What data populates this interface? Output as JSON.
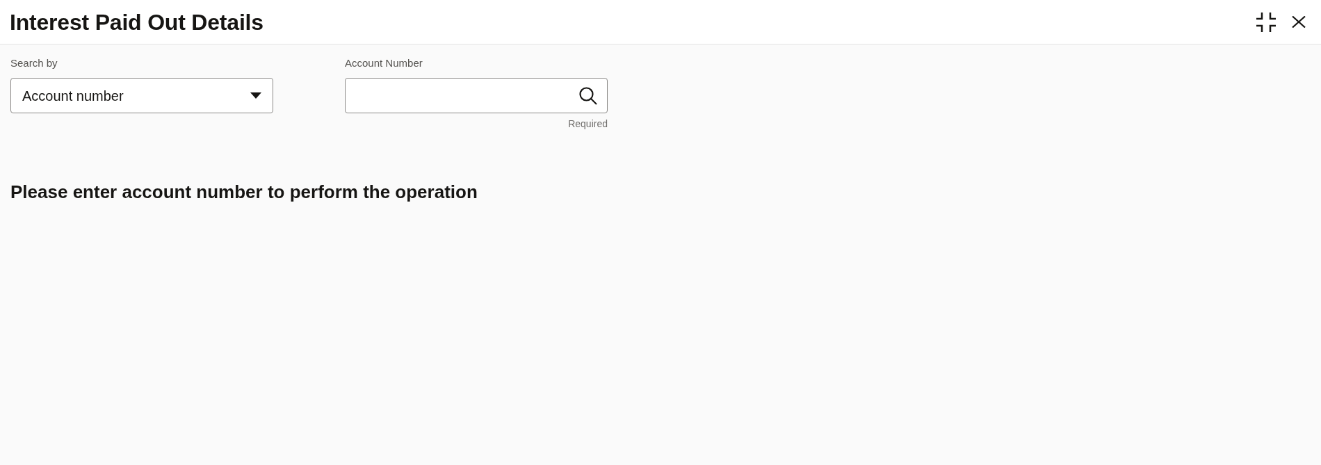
{
  "header": {
    "title": "Interest Paid Out Details"
  },
  "search_by": {
    "label": "Search by",
    "value": "Account number"
  },
  "account_number": {
    "label": "Account Number",
    "helper": "Required"
  },
  "message": "Please enter account number to perform the operation"
}
